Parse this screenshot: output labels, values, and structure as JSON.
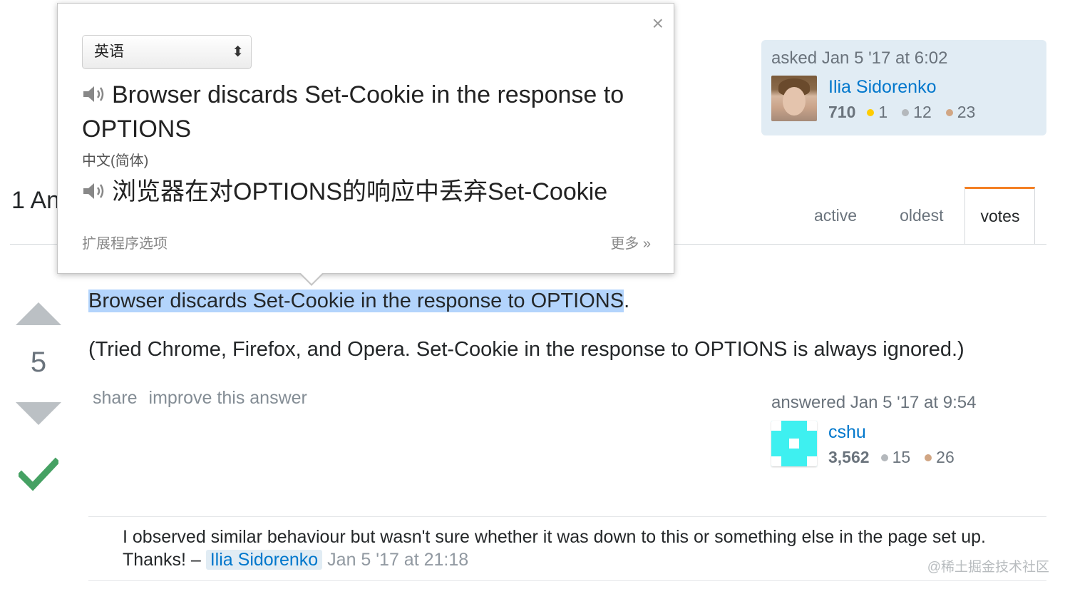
{
  "question_owner": {
    "asked_time": "asked Jan 5 '17 at 6:02",
    "name": "Ilia Sidorenko",
    "reputation": "710",
    "gold": "1",
    "silver": "12",
    "bronze": "23"
  },
  "answers_header": "1 An",
  "sort_tabs": [
    "active",
    "oldest",
    "votes"
  ],
  "answer": {
    "votes": "5",
    "highlighted_text": "Browser discards Set-Cookie in the response to OPTIONS",
    "first_para_end": ".",
    "second_para": "(Tried Chrome, Firefox, and Opera. Set-Cookie in the response to OPTIONS is always ignored.)",
    "share": "share",
    "improve": "improve this answer",
    "answered_time": "answered Jan 5 '17 at 9:54",
    "author": "cshu",
    "reputation": "3,562",
    "silver": "15",
    "bronze": "26"
  },
  "comment": {
    "text": "I observed similar behaviour but wasn't sure whether it was down to this or something else in the page set up. Thanks! – ",
    "user": "Ilia Sidorenko",
    "date": "Jan 5 '17 at 21:18"
  },
  "translate_popup": {
    "close": "×",
    "source_language": "英语",
    "source_text": "Browser discards Set-Cookie in the response to OPTIONS",
    "target_language": "中文(简体)",
    "target_text": "浏览器在对OPTIONS的响应中丢弃Set-Cookie",
    "extension_options": "扩展程序选项",
    "more": "更多 »"
  },
  "watermark": "@稀土掘金技术社区",
  "colors": {
    "accent_orange": "#f48024",
    "link_blue": "#0077cc",
    "selection": "#b3d4fc",
    "accepted_green": "#45a163"
  }
}
